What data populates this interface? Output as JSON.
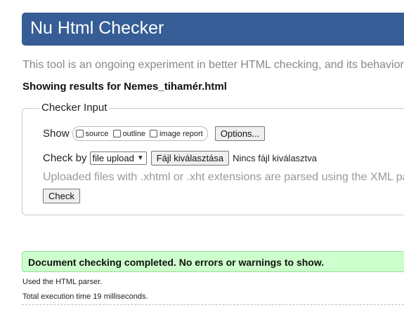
{
  "header": {
    "title": "Nu Html Checker"
  },
  "intro_text": "This tool is an ongoing experiment in better HTML checking, and its behavior",
  "results_for": "Showing results for Nemes_tihamér.html",
  "checker_input": {
    "legend": "Checker Input",
    "show_label": "Show",
    "show_options": [
      {
        "label": "source",
        "checked": false
      },
      {
        "label": "outline",
        "checked": false
      },
      {
        "label": "image report",
        "checked": false
      }
    ],
    "options_button": "Options...",
    "check_by_label": "Check by",
    "check_by_value": "file upload",
    "file_button": "Fájl kiválasztása",
    "no_file_text": "Nincs fájl kiválasztva",
    "upload_note": "Uploaded files with .xhtml or .xht extensions are parsed using the XML pa",
    "check_button": "Check"
  },
  "status": {
    "message": "Document checking completed. No errors or warnings to show.",
    "parser_note": "Used the HTML parser.",
    "execution_time": "Total execution time 19 milliseconds."
  },
  "colors": {
    "header_bg": "#365d95",
    "success_bg": "#ccffcc"
  }
}
